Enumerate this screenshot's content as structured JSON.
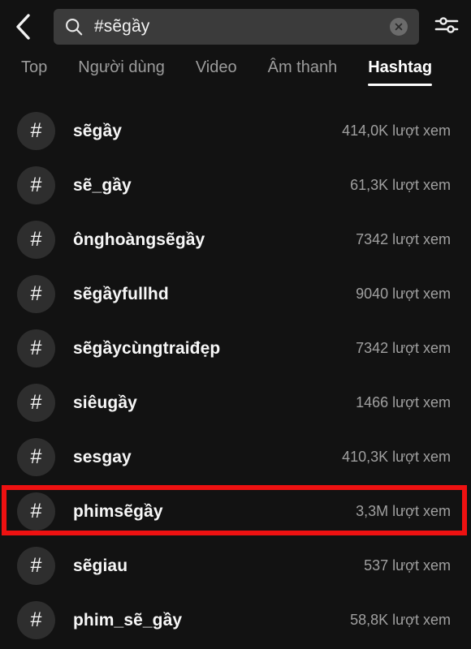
{
  "app": {
    "name": "TikTok Search",
    "background_color": "#121212"
  },
  "topbar": {
    "back_icon": "chevron-left-icon",
    "search": {
      "icon": "search-icon",
      "value": "#sẽgầy",
      "placeholder": "Tìm kiếm",
      "clear_icon": "close-circle-icon",
      "background_color": "#3b3b3b"
    },
    "filter_icon": "sliders-filter-icon"
  },
  "tabs": {
    "active_index": 4,
    "items": [
      {
        "label": "Top"
      },
      {
        "label": "Người dùng"
      },
      {
        "label": "Video"
      },
      {
        "label": "Âm thanh"
      },
      {
        "label": "Hashtag"
      }
    ]
  },
  "results": {
    "hash_glyph": "#",
    "items": [
      {
        "name": "sẽgầy",
        "views": "414,0K lượt xem",
        "highlighted": false
      },
      {
        "name": "sẽ_gầy",
        "views": "61,3K lượt xem",
        "highlighted": false
      },
      {
        "name": "ônghoàngsẽgầy",
        "views": "7342 lượt xem",
        "highlighted": false
      },
      {
        "name": "sẽgầyfullhd",
        "views": "9040 lượt xem",
        "highlighted": false
      },
      {
        "name": "sẽgầycùngtraiđẹp",
        "views": "7342 lượt xem",
        "highlighted": false
      },
      {
        "name": "siêugầy",
        "views": "1466 lượt xem",
        "highlighted": false
      },
      {
        "name": "sesgay",
        "views": "410,3K lượt xem",
        "highlighted": false
      },
      {
        "name": "phimsẽgầy",
        "views": "3,3M lượt xem",
        "highlighted": true
      },
      {
        "name": "sẽgiau",
        "views": "537 lượt xem",
        "highlighted": false
      },
      {
        "name": "phim_sẽ_gầy",
        "views": "58,8K lượt xem",
        "highlighted": false
      }
    ]
  },
  "annotation": {
    "color": "#ee1111",
    "target": "phimsẽgầy"
  }
}
